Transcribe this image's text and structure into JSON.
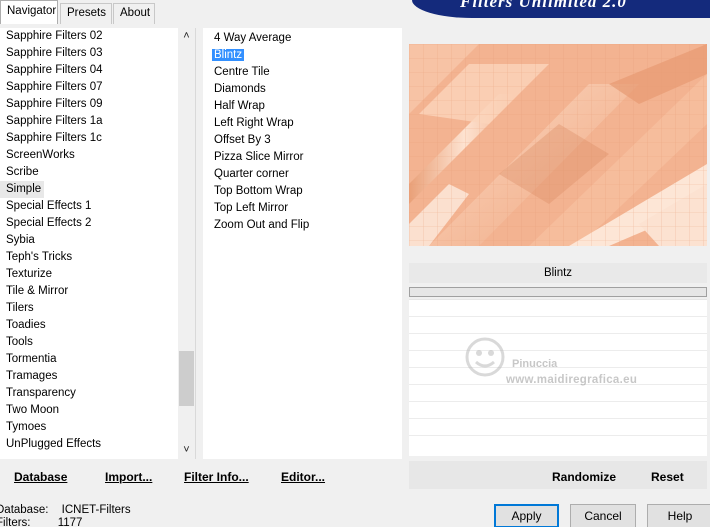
{
  "tabs": [
    {
      "label": "Navigator"
    },
    {
      "label": "Presets"
    },
    {
      "label": "About"
    }
  ],
  "banner": "Filters Unlimited 2.0",
  "categories": [
    "Sapphire Filters 02",
    "Sapphire Filters 03",
    "Sapphire Filters 04",
    "Sapphire Filters 07",
    "Sapphire Filters 09",
    "Sapphire Filters 1a",
    "Sapphire Filters 1c",
    "ScreenWorks",
    "Scribe",
    "Simple",
    "Special Effects 1",
    "Special Effects 2",
    "Sybia",
    "Teph's Tricks",
    "Texturize",
    "Tile & Mirror",
    "Tilers",
    "Toadies",
    "Tools",
    "Tormentia",
    "Tramages",
    "Transparency",
    "Two Moon",
    "Tymoes",
    "UnPlugged Effects"
  ],
  "selected_category": "Simple",
  "filters": [
    "4 Way Average",
    "Blintz",
    "Centre Tile",
    "Diamonds",
    "Half Wrap",
    "Left Right Wrap",
    "Offset By 3",
    "Pizza Slice Mirror",
    "Quarter corner",
    "Top Bottom Wrap",
    "Top Left Mirror",
    "Zoom Out and Flip"
  ],
  "selected_filter": "Blintz",
  "preview": {
    "filter_name": "Blintz",
    "colors": {
      "base": "#f3b391",
      "light": "#fbd9c3",
      "dark": "#d98a62"
    }
  },
  "watermark": {
    "name": "Pinuccia",
    "url": "www.maidiregrafica.eu"
  },
  "toolbar": {
    "database": "Database",
    "import": "Import...",
    "filter_info": "Filter Info...",
    "editor": "Editor...",
    "randomize": "Randomize",
    "reset": "Reset"
  },
  "status": {
    "database_label": "Database:",
    "database_value": "ICNET-Filters",
    "filters_label": "Filters:",
    "filters_value": "1177"
  },
  "buttons": {
    "apply": "Apply",
    "cancel": "Cancel",
    "help": "Help"
  },
  "icons": {
    "scroll_up": "chevron-up-icon",
    "scroll_down": "chevron-down-icon"
  }
}
